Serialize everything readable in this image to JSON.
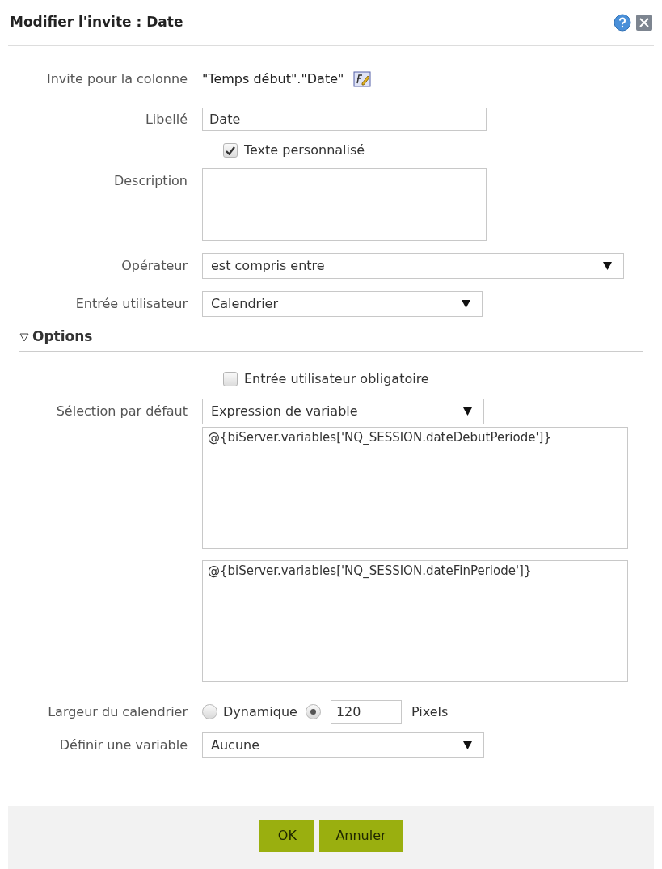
{
  "dialog": {
    "title": "Modifier l'invite : Date"
  },
  "column": {
    "label": "Invite pour la colonne",
    "value": "\"Temps début\".\"Date\""
  },
  "caption": {
    "label": "Libellé",
    "value": "Date"
  },
  "custom_text": {
    "label": "Texte personnalisé",
    "checked": true
  },
  "description": {
    "label": "Description"
  },
  "operator": {
    "label": "Opérateur",
    "value": "est compris entre"
  },
  "user_input": {
    "label": "Entrée utilisateur",
    "value": "Calendrier"
  },
  "options": {
    "title": "Options",
    "expanded": true,
    "required": {
      "label": "Entrée utilisateur obligatoire",
      "checked": false
    },
    "default_selection": {
      "label": "Sélection par défaut",
      "value": "Expression de variable",
      "expressions": [
        "@{biServer.variables['NQ_SESSION.dateDebutPeriode']}",
        "@{biServer.variables['NQ_SESSION.dateFinPeriode']}"
      ]
    },
    "calendar_width": {
      "label": "Largeur du calendrier",
      "dynamic": {
        "label": "Dynamique",
        "selected": false
      },
      "fixed": {
        "selected": true,
        "value": "120",
        "unit": "Pixels"
      }
    },
    "set_variable": {
      "label": "Définir une variable",
      "value": "Aucune"
    }
  },
  "buttons": [
    "OK",
    "Annuler"
  ]
}
